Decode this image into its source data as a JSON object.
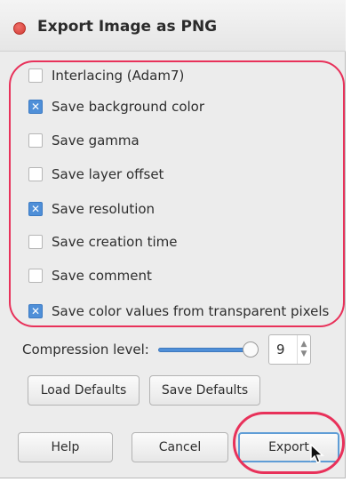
{
  "dialog": {
    "title": "Export Image as PNG"
  },
  "options": [
    {
      "label": "Interlacing (Adam7)",
      "checked": false
    },
    {
      "label": "Save background color",
      "checked": true
    },
    {
      "label": "Save gamma",
      "checked": false
    },
    {
      "label": "Save layer offset",
      "checked": false
    },
    {
      "label": "Save resolution",
      "checked": true
    },
    {
      "label": "Save creation time",
      "checked": false
    },
    {
      "label": "Save comment",
      "checked": false
    },
    {
      "label": "Save color values from transparent pixels",
      "checked": true
    }
  ],
  "compression": {
    "label": "Compression level:",
    "value": "9",
    "slider_fraction": 1.0
  },
  "defaults_buttons": {
    "load": "Load Defaults",
    "save": "Save Defaults"
  },
  "bottom_buttons": {
    "help": "Help",
    "cancel": "Cancel",
    "export": "Export"
  },
  "colors": {
    "annotation_red": "#e8315a",
    "accent_blue": "#4f8fd8",
    "close_red": "#d23b34"
  },
  "icons": {
    "close": "close-icon",
    "check": "checkmark-icon",
    "cursor": "mouse-pointer-icon"
  }
}
